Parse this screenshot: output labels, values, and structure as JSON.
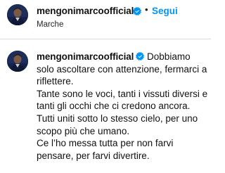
{
  "post_header": {
    "username": "mengonimarcoofficial",
    "separator": "•",
    "follow_label": "Segui",
    "location": "Marche",
    "verified_icon": "verified-badge-icon",
    "accent_color": "#0095f6"
  },
  "caption": {
    "username": "mengonimarcoofficial",
    "verified_icon": "verified-badge-icon",
    "lead": "Dobbiamo solo ascoltare con attenzione, fermarci a riflettere.",
    "lines": [
      "Tante sono le voci, tanti i vissuti diversi e tanti gli occhi che ci credono ancora.",
      "Tutti uniti sotto lo stesso cielo, per uno scopo più che umano.",
      "Ce l’ho messa tutta per non farvi pensare, per farvi divertire."
    ]
  }
}
